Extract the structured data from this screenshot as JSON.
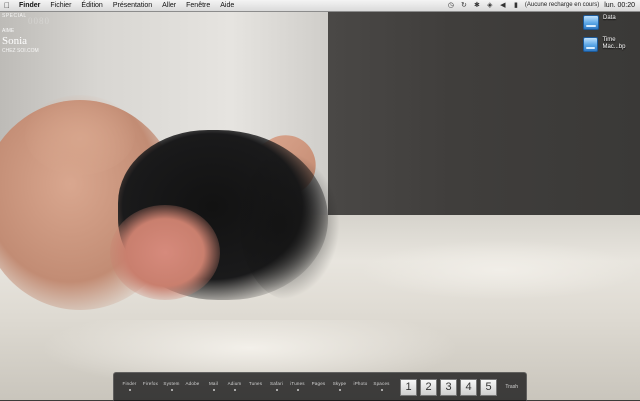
{
  "menubar": {
    "apple_icon": "apple-icon",
    "items": [
      "Finder",
      "Fichier",
      "Édition",
      "Présentation",
      "Aller",
      "Fenêtre",
      "Aide"
    ],
    "status_text": "(Aucune recharge en cours)",
    "clock": "lun. 00:20",
    "tray_icons": [
      "clock-icon",
      "sync-icon",
      "bluetooth-icon",
      "wifi-icon",
      "volume-icon",
      "battery-icon"
    ]
  },
  "widget": {
    "tag": "SPECIAL",
    "code": "0080",
    "aime": "AIME",
    "name": "Sonia",
    "sub": "CHEZ SOI.COM"
  },
  "desktop_icons": [
    {
      "label": "Data",
      "icon": "drive-icon"
    },
    {
      "label": "Time Mac...bp",
      "icon": "drive-icon"
    }
  ],
  "dock": {
    "apps": [
      {
        "label": "Finder",
        "running": true
      },
      {
        "label": "Firefox",
        "running": false
      },
      {
        "label": "System",
        "running": true
      },
      {
        "label": "Adobe",
        "running": false
      },
      {
        "label": "Mail",
        "running": true
      },
      {
        "label": "Adium",
        "running": true
      },
      {
        "label": "Tunes",
        "running": false
      },
      {
        "label": "Safari",
        "running": true
      },
      {
        "label": "iTunes",
        "running": true
      },
      {
        "label": "Pages",
        "running": false
      },
      {
        "label": "Skype",
        "running": true
      },
      {
        "label": "iPhoto",
        "running": false
      },
      {
        "label": "Spaces",
        "running": true
      }
    ],
    "spaces": [
      "1",
      "2",
      "3",
      "4",
      "5"
    ],
    "trash_label": "Trash"
  },
  "colors": {
    "menubar_bg": "#e8e8e8",
    "dock_bg": "#141416",
    "drive_blue": "#5aa6e6"
  }
}
